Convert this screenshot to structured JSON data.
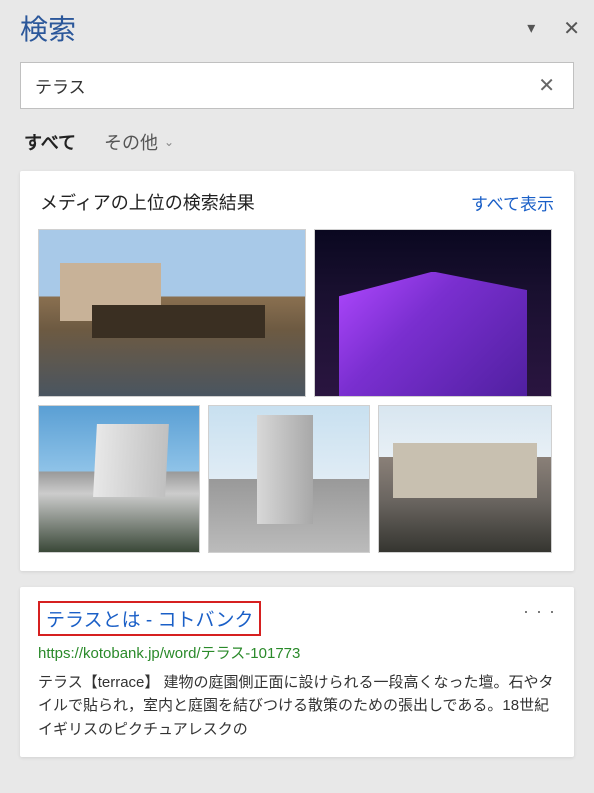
{
  "header": {
    "title": "検索"
  },
  "search": {
    "value": "テラス"
  },
  "tabs": {
    "all": "すべて",
    "other": "その他"
  },
  "media": {
    "title": "メディアの上位の検索結果",
    "showAll": "すべて表示"
  },
  "result": {
    "title": "テラスとは - コトバンク",
    "url": "https://kotobank.jp/word/テラス-101773",
    "desc": "テラス【terrace】 建物の庭園側正面に設けられる一段高くなった壇。石やタイルで貼られ，室内と庭園を結びつける散策のための張出しである。18世紀イギリスのピクチュアレスクの"
  }
}
